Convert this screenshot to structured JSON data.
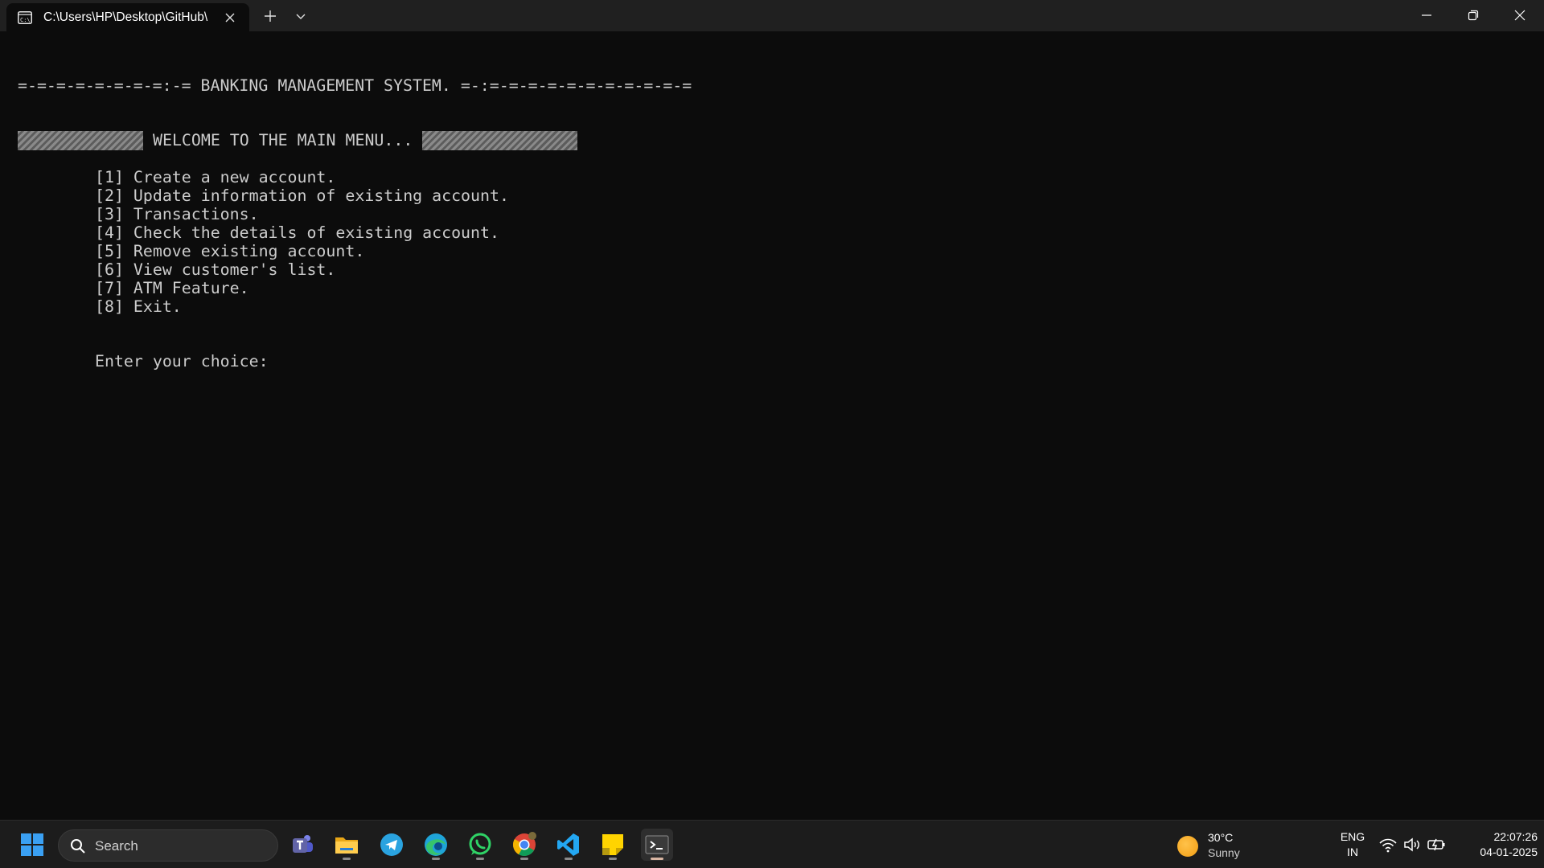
{
  "window": {
    "tab_title": "C:\\Users\\HP\\Desktop\\GitHub\\"
  },
  "console": {
    "banner": "=-=-=-=-=-=-=-=:-= BANKING MANAGEMENT SYSTEM. =-:=-=-=-=-=-=-=-=-=-=-=",
    "welcome": "WELCOME TO THE MAIN MENU...",
    "menu_items": [
      "[1] Create a new account.",
      "[2] Update information of existing account.",
      "[3] Transactions.",
      "[4] Check the details of existing account.",
      "[5] Remove existing account.",
      "[6] View customer's list.",
      "[7] ATM Feature.",
      "[8] Exit."
    ],
    "prompt": "Enter your choice:"
  },
  "taskbar": {
    "search_placeholder": "Search",
    "apps": [
      "start-icon",
      "teams-icon",
      "file-explorer-icon",
      "telegram-icon",
      "edge-icon",
      "whatsapp-icon",
      "chrome-icon",
      "vscode-icon",
      "sticky-notes-icon",
      "terminal-icon"
    ],
    "weather": {
      "temp": "30°C",
      "condition": "Sunny"
    },
    "language": {
      "line1": "ENG",
      "line2": "IN"
    },
    "clock": {
      "time": "22:07:26",
      "date": "04-01-2025"
    }
  },
  "colors": {
    "console_bg": "#0c0c0c",
    "console_text": "#cccccc",
    "titlebar_bg": "#202020",
    "taskbar_bg": "#1c1c1c"
  }
}
